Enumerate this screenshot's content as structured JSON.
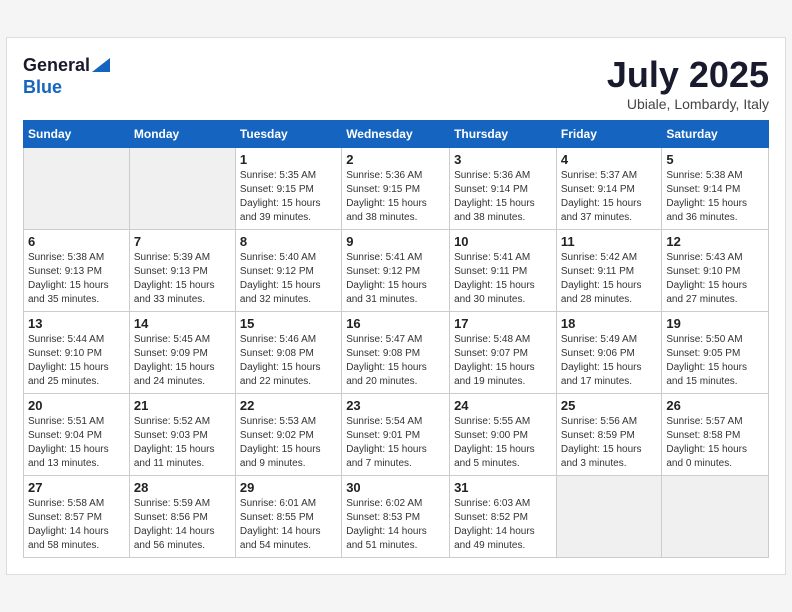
{
  "header": {
    "logo_general": "General",
    "logo_blue": "Blue",
    "month_year": "July 2025",
    "location": "Ubiale, Lombardy, Italy"
  },
  "weekdays": [
    "Sunday",
    "Monday",
    "Tuesday",
    "Wednesday",
    "Thursday",
    "Friday",
    "Saturday"
  ],
  "weeks": [
    [
      {
        "num": "",
        "info": "",
        "empty": true
      },
      {
        "num": "",
        "info": "",
        "empty": true
      },
      {
        "num": "1",
        "info": "Sunrise: 5:35 AM\nSunset: 9:15 PM\nDaylight: 15 hours\nand 39 minutes."
      },
      {
        "num": "2",
        "info": "Sunrise: 5:36 AM\nSunset: 9:15 PM\nDaylight: 15 hours\nand 38 minutes."
      },
      {
        "num": "3",
        "info": "Sunrise: 5:36 AM\nSunset: 9:14 PM\nDaylight: 15 hours\nand 38 minutes."
      },
      {
        "num": "4",
        "info": "Sunrise: 5:37 AM\nSunset: 9:14 PM\nDaylight: 15 hours\nand 37 minutes."
      },
      {
        "num": "5",
        "info": "Sunrise: 5:38 AM\nSunset: 9:14 PM\nDaylight: 15 hours\nand 36 minutes."
      }
    ],
    [
      {
        "num": "6",
        "info": "Sunrise: 5:38 AM\nSunset: 9:13 PM\nDaylight: 15 hours\nand 35 minutes."
      },
      {
        "num": "7",
        "info": "Sunrise: 5:39 AM\nSunset: 9:13 PM\nDaylight: 15 hours\nand 33 minutes."
      },
      {
        "num": "8",
        "info": "Sunrise: 5:40 AM\nSunset: 9:12 PM\nDaylight: 15 hours\nand 32 minutes."
      },
      {
        "num": "9",
        "info": "Sunrise: 5:41 AM\nSunset: 9:12 PM\nDaylight: 15 hours\nand 31 minutes."
      },
      {
        "num": "10",
        "info": "Sunrise: 5:41 AM\nSunset: 9:11 PM\nDaylight: 15 hours\nand 30 minutes."
      },
      {
        "num": "11",
        "info": "Sunrise: 5:42 AM\nSunset: 9:11 PM\nDaylight: 15 hours\nand 28 minutes."
      },
      {
        "num": "12",
        "info": "Sunrise: 5:43 AM\nSunset: 9:10 PM\nDaylight: 15 hours\nand 27 minutes."
      }
    ],
    [
      {
        "num": "13",
        "info": "Sunrise: 5:44 AM\nSunset: 9:10 PM\nDaylight: 15 hours\nand 25 minutes."
      },
      {
        "num": "14",
        "info": "Sunrise: 5:45 AM\nSunset: 9:09 PM\nDaylight: 15 hours\nand 24 minutes."
      },
      {
        "num": "15",
        "info": "Sunrise: 5:46 AM\nSunset: 9:08 PM\nDaylight: 15 hours\nand 22 minutes."
      },
      {
        "num": "16",
        "info": "Sunrise: 5:47 AM\nSunset: 9:08 PM\nDaylight: 15 hours\nand 20 minutes."
      },
      {
        "num": "17",
        "info": "Sunrise: 5:48 AM\nSunset: 9:07 PM\nDaylight: 15 hours\nand 19 minutes."
      },
      {
        "num": "18",
        "info": "Sunrise: 5:49 AM\nSunset: 9:06 PM\nDaylight: 15 hours\nand 17 minutes."
      },
      {
        "num": "19",
        "info": "Sunrise: 5:50 AM\nSunset: 9:05 PM\nDaylight: 15 hours\nand 15 minutes."
      }
    ],
    [
      {
        "num": "20",
        "info": "Sunrise: 5:51 AM\nSunset: 9:04 PM\nDaylight: 15 hours\nand 13 minutes."
      },
      {
        "num": "21",
        "info": "Sunrise: 5:52 AM\nSunset: 9:03 PM\nDaylight: 15 hours\nand 11 minutes."
      },
      {
        "num": "22",
        "info": "Sunrise: 5:53 AM\nSunset: 9:02 PM\nDaylight: 15 hours\nand 9 minutes."
      },
      {
        "num": "23",
        "info": "Sunrise: 5:54 AM\nSunset: 9:01 PM\nDaylight: 15 hours\nand 7 minutes."
      },
      {
        "num": "24",
        "info": "Sunrise: 5:55 AM\nSunset: 9:00 PM\nDaylight: 15 hours\nand 5 minutes."
      },
      {
        "num": "25",
        "info": "Sunrise: 5:56 AM\nSunset: 8:59 PM\nDaylight: 15 hours\nand 3 minutes."
      },
      {
        "num": "26",
        "info": "Sunrise: 5:57 AM\nSunset: 8:58 PM\nDaylight: 15 hours\nand 0 minutes."
      }
    ],
    [
      {
        "num": "27",
        "info": "Sunrise: 5:58 AM\nSunset: 8:57 PM\nDaylight: 14 hours\nand 58 minutes."
      },
      {
        "num": "28",
        "info": "Sunrise: 5:59 AM\nSunset: 8:56 PM\nDaylight: 14 hours\nand 56 minutes."
      },
      {
        "num": "29",
        "info": "Sunrise: 6:01 AM\nSunset: 8:55 PM\nDaylight: 14 hours\nand 54 minutes."
      },
      {
        "num": "30",
        "info": "Sunrise: 6:02 AM\nSunset: 8:53 PM\nDaylight: 14 hours\nand 51 minutes."
      },
      {
        "num": "31",
        "info": "Sunrise: 6:03 AM\nSunset: 8:52 PM\nDaylight: 14 hours\nand 49 minutes."
      },
      {
        "num": "",
        "info": "",
        "empty": true
      },
      {
        "num": "",
        "info": "",
        "empty": true
      }
    ]
  ]
}
